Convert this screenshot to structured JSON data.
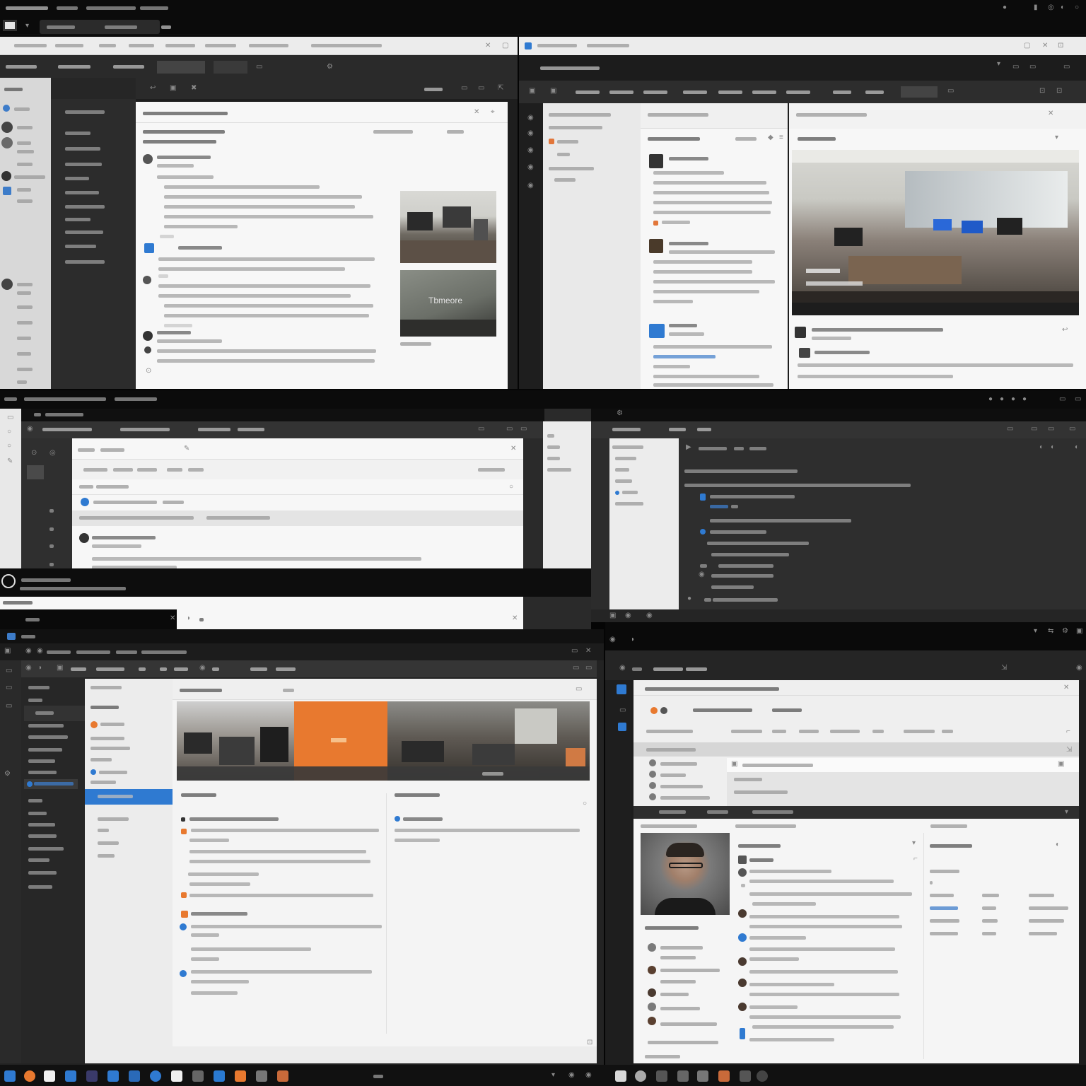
{
  "colors": {
    "accent_blue": "#2f7ad1",
    "accent_orange": "#e8792f",
    "chrome_dark": "#0b0b0b",
    "sidebar_dark": "#2c2c2c",
    "panel_light": "#f7f7f7"
  },
  "windows": [
    {
      "name": "window-top-left",
      "title": "",
      "kind": "message-thread-dark-sidebar"
    },
    {
      "name": "window-top-right",
      "title": "",
      "kind": "message-thread-with-office-photo"
    },
    {
      "name": "window-middle-left",
      "title": "",
      "kind": "inbox-list"
    },
    {
      "name": "window-middle-right",
      "title": "",
      "kind": "dark-thread-list"
    },
    {
      "name": "window-bottom-left",
      "title": "",
      "kind": "feed-with-photo-strip"
    },
    {
      "name": "window-bottom-right",
      "title": "",
      "kind": "profile-and-activity"
    }
  ],
  "photos": {
    "office_small": "office-photo",
    "whiteboard": "whiteboard-photo",
    "office_large": "office-photo-large",
    "meeting_left": "meeting-photo",
    "meeting_right": "meeting-photo",
    "portrait": "portrait-photo"
  },
  "icons": [
    "search-icon",
    "gear-icon",
    "close-icon",
    "chevron-down-icon",
    "avatar-icon",
    "folder-icon",
    "mail-icon",
    "calendar-icon"
  ],
  "taskbar": {
    "icons": [
      "start-icon",
      "browser-icon",
      "files-icon",
      "mail-icon",
      "store-icon",
      "chat-icon",
      "calendar-icon",
      "photos-icon",
      "notes-icon",
      "media-icon",
      "settings-icon"
    ]
  }
}
